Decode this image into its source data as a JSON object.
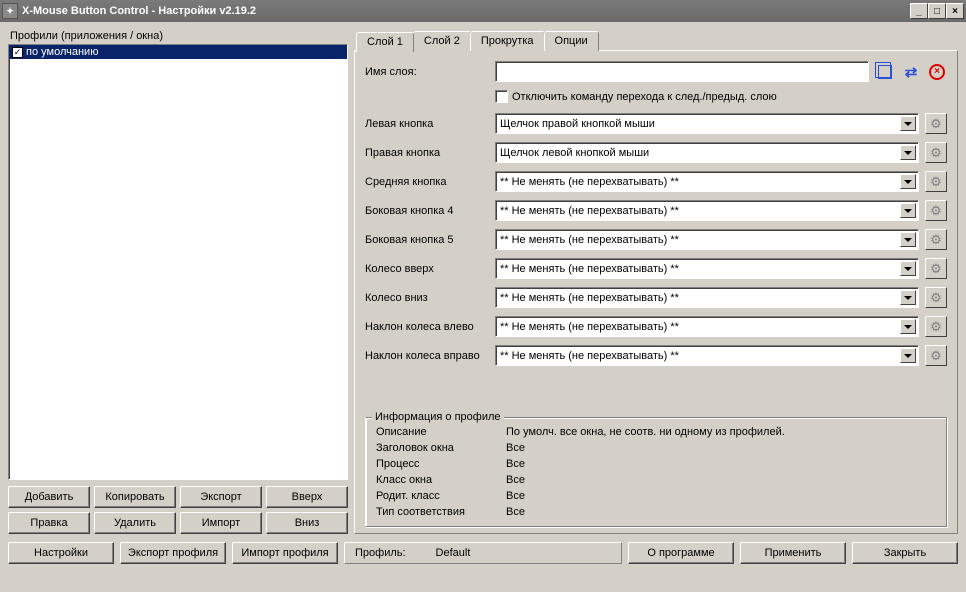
{
  "window": {
    "title": "X-Mouse Button Control - Настройки v2.19.2"
  },
  "left": {
    "label": "Профили (приложения / окна)",
    "profile_default": "по умолчанию",
    "buttons": {
      "add": "Добавить",
      "copy": "Копировать",
      "export": "Экспорт",
      "up": "Вверх",
      "edit": "Правка",
      "delete": "Удалить",
      "import": "Импорт",
      "down": "Вниз"
    }
  },
  "tabs": {
    "layer1": "Слой 1",
    "layer2": "Слой 2",
    "scroll": "Прокрутка",
    "options": "Опции"
  },
  "layer": {
    "name_label": "Имя слоя:",
    "name_value": "",
    "disable_switch": "Отключить команду перехода к след./предыд. слою",
    "rows": [
      {
        "label": "Левая кнопка",
        "value": "Щелчок правой кнопкой мыши"
      },
      {
        "label": "Правая кнопка",
        "value": "Щелчок левой кнопкой мыши"
      },
      {
        "label": "Средняя кнопка",
        "value": "** Не менять (не перехватывать) **"
      },
      {
        "label": "Боковая кнопка 4",
        "value": "** Не менять (не перехватывать) **"
      },
      {
        "label": "Боковая кнопка 5",
        "value": "** Не менять (не перехватывать) **"
      },
      {
        "label": "Колесо вверх",
        "value": "** Не менять (не перехватывать) **"
      },
      {
        "label": "Колесо вниз",
        "value": "** Не менять (не перехватывать) **"
      },
      {
        "label": "Наклон колеса влево",
        "value": "** Не менять (не перехватывать) **"
      },
      {
        "label": "Наклон колеса вправо",
        "value": "** Не менять (не перехватывать) **"
      }
    ]
  },
  "info": {
    "legend": "Информация о профиле",
    "rows": [
      {
        "key": "Описание",
        "value": "По умолч. все окна, не соотв. ни одному из профилей."
      },
      {
        "key": "Заголовок окна",
        "value": "Все"
      },
      {
        "key": "Процесс",
        "value": "Все"
      },
      {
        "key": "Класс окна",
        "value": "Все"
      },
      {
        "key": "Родит. класс",
        "value": "Все"
      },
      {
        "key": "Тип соответствия",
        "value": "Все"
      }
    ]
  },
  "bottom": {
    "settings": "Настройки",
    "export_profile": "Экспорт профиля",
    "import_profile": "Импорт профиля",
    "profile_label": "Профиль:",
    "profile_value": "Default",
    "about": "О программе",
    "apply": "Применить",
    "close": "Закрыть"
  }
}
